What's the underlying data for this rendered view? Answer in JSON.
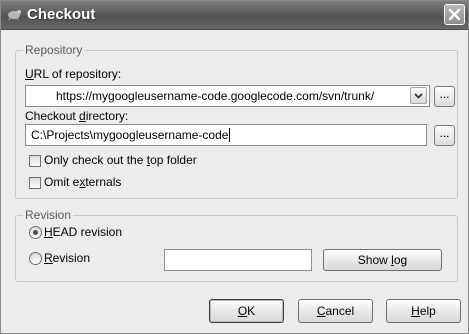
{
  "window": {
    "title": "Checkout"
  },
  "repository_group": {
    "legend": "Repository",
    "url_label_pre": "",
    "url_label_mnemonic": "U",
    "url_label_post": "RL of repository:",
    "url_value": "https://mygoogleusername-code.googlecode.com/svn/trunk/",
    "dir_label_pre": "Checkout ",
    "dir_label_mnemonic": "d",
    "dir_label_post": "irectory:",
    "dir_value": "C:\\Projects\\mygoogleusername-code",
    "browse_label": "...",
    "top_folder_pre": "Only check out the ",
    "top_folder_mnemonic": "t",
    "top_folder_post": "op folder",
    "top_folder_checked": false,
    "externals_pre": "Omit e",
    "externals_mnemonic": "x",
    "externals_post": "ternals",
    "externals_checked": false
  },
  "revision_group": {
    "legend": "Revision",
    "head_pre": "",
    "head_mnemonic": "H",
    "head_post": "EAD revision",
    "head_selected": true,
    "revision_pre": "",
    "revision_mnemonic": "R",
    "revision_post": "evision",
    "revision_selected": false,
    "revision_value": "",
    "showlog_pre": "Show ",
    "showlog_mnemonic": "l",
    "showlog_post": "og"
  },
  "buttons": {
    "ok_mnemonic": "O",
    "ok_post": "K",
    "cancel_mnemonic": "C",
    "cancel_post": "ancel",
    "help_mnemonic": "H",
    "help_post": "elp"
  }
}
